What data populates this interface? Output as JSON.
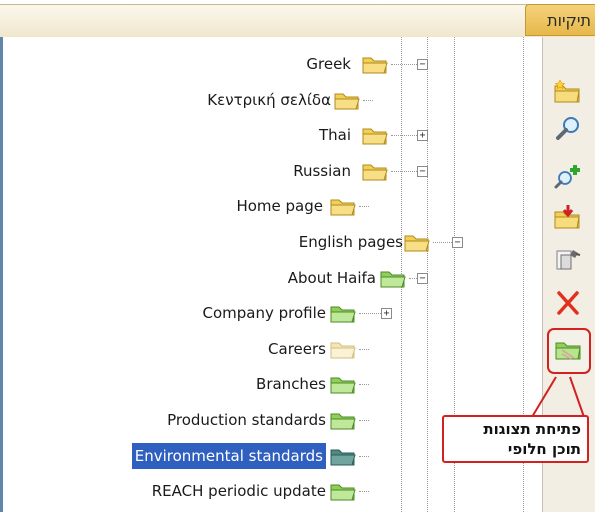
{
  "panel": {
    "title": "תיקיות"
  },
  "tree": {
    "items": [
      {
        "label": "Greek",
        "folder": "yellow",
        "expander": "minus",
        "selected": false
      },
      {
        "label": "Κεντρική σελίδα",
        "folder": "yellow",
        "expander": "none",
        "selected": false
      },
      {
        "label": "Thai",
        "folder": "yellow",
        "expander": "plus",
        "selected": false
      },
      {
        "label": "Russian",
        "folder": "yellow",
        "expander": "minus",
        "selected": false
      },
      {
        "label": "Home page",
        "folder": "yellow",
        "expander": "none",
        "selected": false
      },
      {
        "label": "English pages",
        "folder": "yellow",
        "expander": "minus",
        "selected": false
      },
      {
        "label": "About Haifa",
        "folder": "green",
        "expander": "minus",
        "selected": false
      },
      {
        "label": "Company profile",
        "folder": "green",
        "expander": "plus",
        "selected": false
      },
      {
        "label": "Careers",
        "folder": "faded",
        "expander": "none",
        "selected": false
      },
      {
        "label": "Branches",
        "folder": "green",
        "expander": "none",
        "selected": false
      },
      {
        "label": "Production standards",
        "folder": "green",
        "expander": "none",
        "selected": false
      },
      {
        "label": "Environmental standards",
        "folder": "green-selected",
        "expander": "none",
        "selected": true
      },
      {
        "label": "REACH periodic update",
        "folder": "green",
        "expander": "none",
        "selected": false
      }
    ]
  },
  "toolbar": {
    "tools": [
      {
        "name": "new-folder-icon"
      },
      {
        "name": "search-icon"
      },
      {
        "name": "add-content-icon"
      },
      {
        "name": "import-folder-icon"
      },
      {
        "name": "folder-properties-icon"
      },
      {
        "name": "delete-icon"
      },
      {
        "name": "alternative-content-view-icon"
      }
    ]
  },
  "callout": {
    "line1": "פתיחת תצוגות",
    "line2": "תוכן חלופי"
  },
  "colors": {
    "selection": "#2f5fbf",
    "folder_yellow": "#f2cf55",
    "folder_green": "#8fcf5a",
    "callout_red": "#d32020",
    "tree_border": "#5e87a9"
  }
}
